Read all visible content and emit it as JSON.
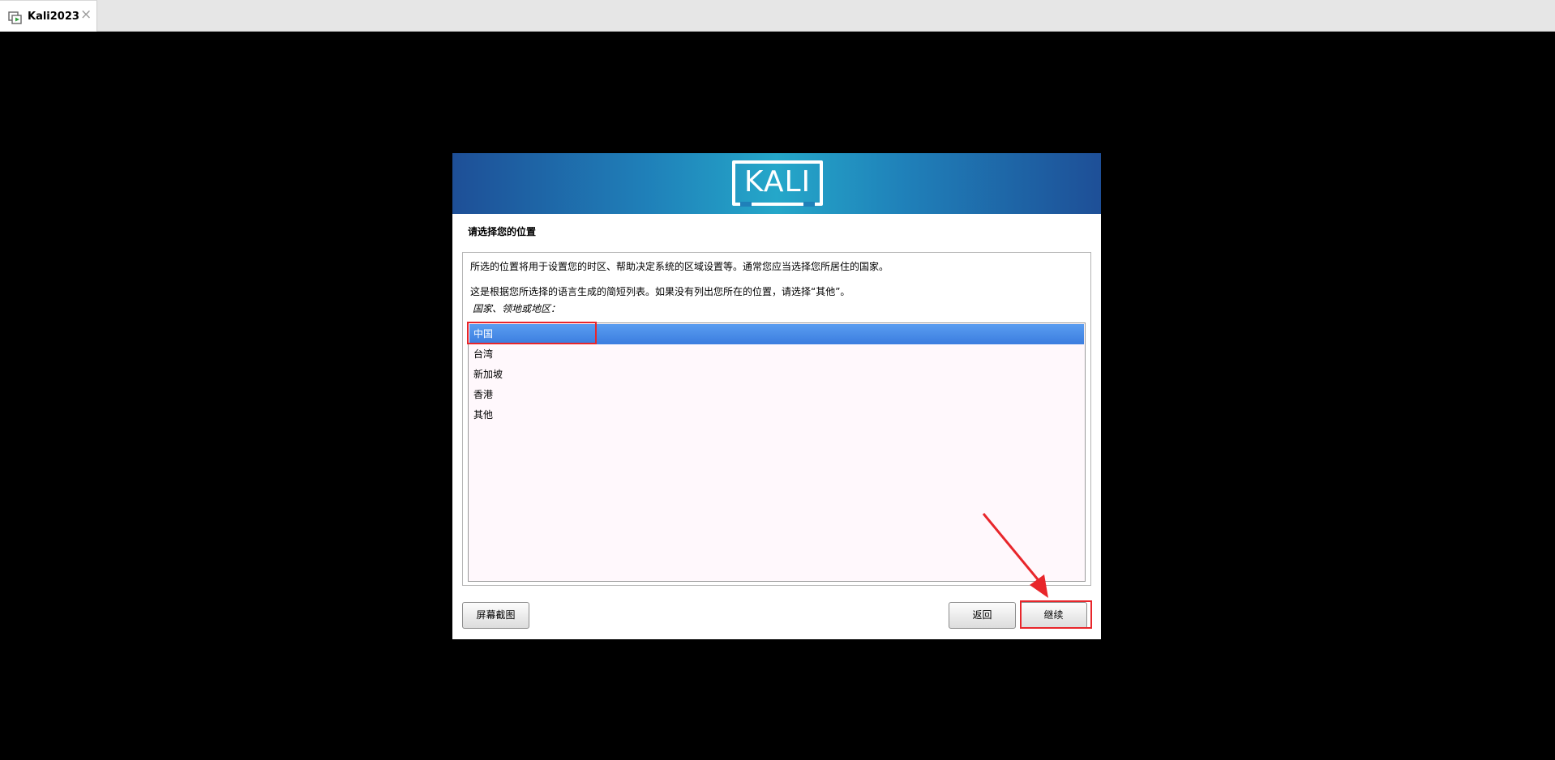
{
  "host_tab": {
    "title": "Kali2023",
    "close_glyph": "×",
    "icon": "vm-play-icon"
  },
  "installer": {
    "logo_text": "KALI",
    "page_title": "请选择您的位置",
    "description_1": "所选的位置将用于设置您的时区、帮助决定系统的区域设置等。通常您应当选择您所居住的国家。",
    "description_2": "这是根据您所选择的语言生成的简短列表。如果没有列出您所在的位置，请选择“其他”。",
    "field_label": "国家、领地或地区：",
    "locations": [
      "中国",
      "台湾",
      "新加坡",
      "香港",
      "其他"
    ],
    "selected_location": "中国",
    "buttons": {
      "screenshot": "屏幕截图",
      "back": "返回",
      "continue": "继续"
    }
  },
  "colors": {
    "selection": "#3b7ddf",
    "annotation": "#e8262b",
    "banner_dark": "#1e4f97",
    "banner_light": "#25a7c9"
  }
}
